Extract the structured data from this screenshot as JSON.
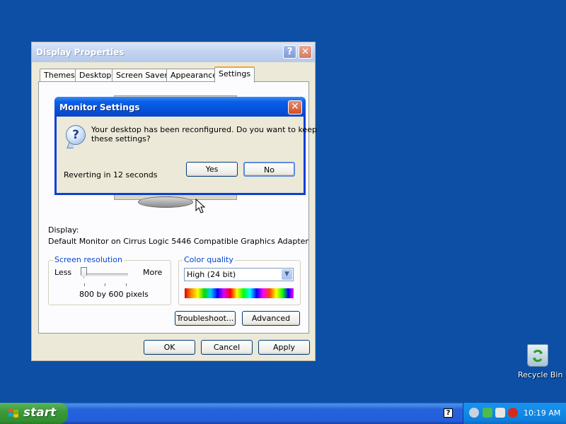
{
  "window": {
    "title": "Display Properties",
    "help_glyph": "?",
    "close_glyph": "✕",
    "tabs": [
      {
        "label": "Themes",
        "active": false
      },
      {
        "label": "Desktop",
        "active": false
      },
      {
        "label": "Screen Saver",
        "active": false
      },
      {
        "label": "Appearance",
        "active": false
      },
      {
        "label": "Settings",
        "active": true
      }
    ],
    "display_label": "Display:",
    "display_value": "Default Monitor on Cirrus Logic 5446 Compatible Graphics Adapter",
    "resolution": {
      "group_label": "Screen resolution",
      "less_label": "Less",
      "more_label": "More",
      "value_text": "800 by 600 pixels",
      "slider_position": 0
    },
    "color_quality": {
      "group_label": "Color quality",
      "selected": "High (24 bit)"
    },
    "troubleshoot_label": "Troubleshoot...",
    "advanced_label": "Advanced",
    "ok_label": "OK",
    "cancel_label": "Cancel",
    "apply_label": "Apply"
  },
  "dialog": {
    "title": "Monitor Settings",
    "close_glyph": "✕",
    "message_line1": "Your desktop has been reconfigured.  Do you want to keep",
    "message_line2": "these settings?",
    "countdown": "Reverting in 12 seconds",
    "yes_label": "Yes",
    "no_label": "No",
    "icon": "question-icon"
  },
  "desktop": {
    "background_color": "#0c4fa5",
    "recycle_bin_label": "Recycle Bin"
  },
  "taskbar": {
    "start_label": "start",
    "clock": "10:19 AM",
    "help_glyph": "?",
    "tray_icons": [
      "speaker-icon",
      "network-icon",
      "security-alert-icon",
      "shield-icon"
    ]
  }
}
